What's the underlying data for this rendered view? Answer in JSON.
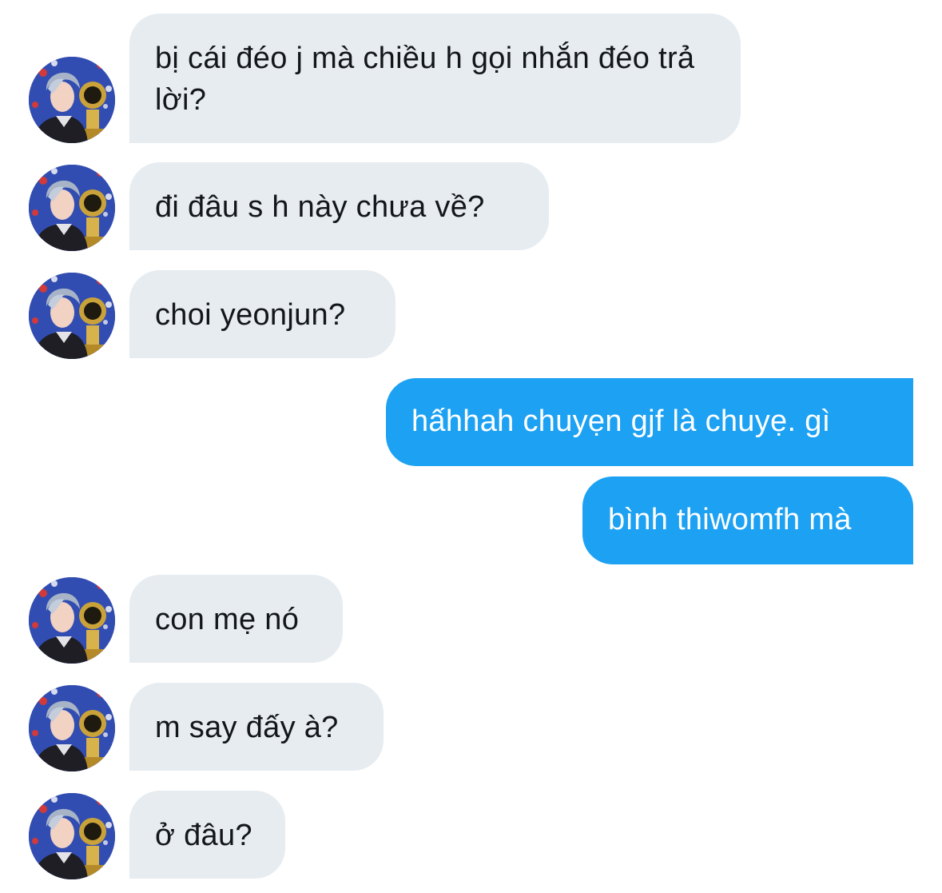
{
  "conversation": {
    "messages": [
      {
        "direction": "received",
        "text": "bị cái đéo j mà chiều h gọi nhắn đéo trả lời?"
      },
      {
        "direction": "received",
        "text": "đi đâu s h này chưa về?"
      },
      {
        "direction": "received",
        "text": "choi yeonjun?"
      },
      {
        "direction": "sent",
        "text": "hấhhah chuyẹn gjf là chuyẹ. gì"
      },
      {
        "direction": "sent",
        "text": "bình thiwomfh mà"
      },
      {
        "direction": "received",
        "text": "con mẹ nó"
      },
      {
        "direction": "received",
        "text": "m say đấy à?"
      },
      {
        "direction": "received",
        "text": "ở đâu?"
      }
    ]
  },
  "colors": {
    "received_bubble": "#e6ecf0",
    "received_text": "#14171a",
    "sent_bubble": "#1da1f2",
    "sent_text": "#ffffff",
    "background": "#ffffff"
  },
  "icons": {
    "avatar": "contact-avatar-photo"
  }
}
